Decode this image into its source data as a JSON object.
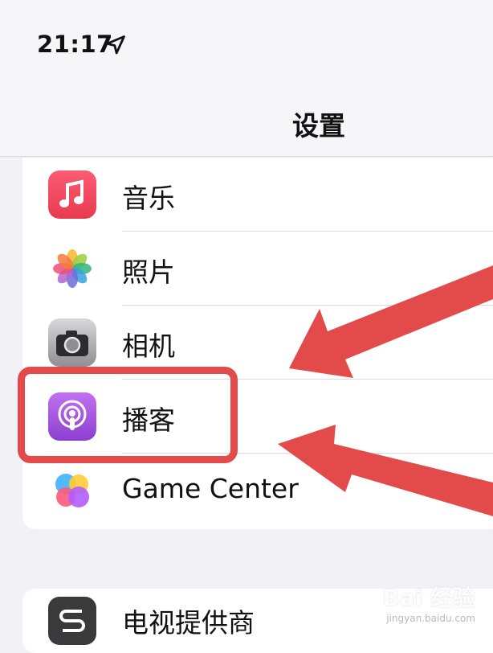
{
  "status_bar": {
    "time": "21:17"
  },
  "nav": {
    "title": "设置"
  },
  "settings_group_1": [
    {
      "label": "音乐",
      "icon": "music-icon"
    },
    {
      "label": "照片",
      "icon": "photos-icon"
    },
    {
      "label": "相机",
      "icon": "camera-icon"
    },
    {
      "label": "播客",
      "icon": "podcast-icon"
    },
    {
      "label": "Game Center",
      "icon": "game-center-icon"
    }
  ],
  "settings_group_2": [
    {
      "label": "电视提供商",
      "icon": "tv-provider-icon"
    }
  ],
  "annotation": {
    "highlight_color": "#e34b4b"
  },
  "watermark": {
    "logo": "Bai 经验",
    "url": "jingyan.baidu.com"
  }
}
